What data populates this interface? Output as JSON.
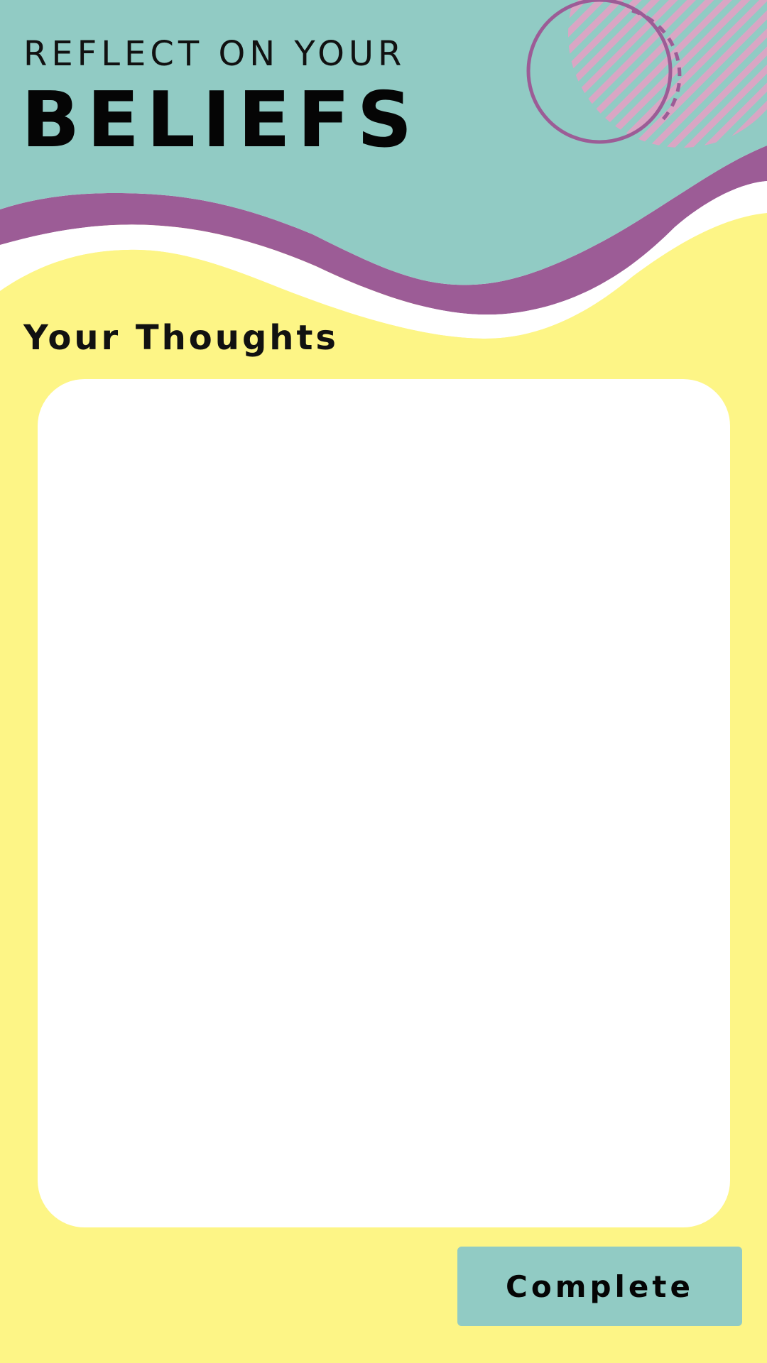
{
  "header": {
    "subtitle": "REFLECT ON YOUR",
    "title": "BELIEFS"
  },
  "section": {
    "title": "Your Thoughts"
  },
  "thoughts_input": {
    "value": "",
    "placeholder": ""
  },
  "actions": {
    "complete_label": "Complete"
  },
  "colors": {
    "background_yellow": "#fdf586",
    "header_teal": "#91cbc4",
    "accent_purple": "#9c5c96",
    "stripe_pink": "#d9a6c4",
    "button_teal": "#91cbc4",
    "text_dark": "#050505"
  },
  "decorations": {
    "icons": [
      "circle-outline-decoration",
      "dashed-circle-decoration",
      "striped-circle-decoration",
      "purple-wave-decoration"
    ]
  }
}
